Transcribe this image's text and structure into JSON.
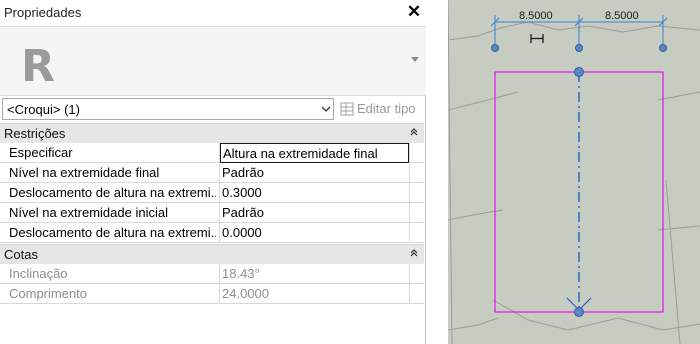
{
  "palette": {
    "title": "Propriedades",
    "close_glyph": "✕",
    "type_thumbnail_letter": "R",
    "instance_filter": "<Croqui> (1)",
    "edit_type_label": "Editar tipo"
  },
  "categories": [
    {
      "label": "Restrições",
      "rows": [
        {
          "name": "Especificar",
          "value": "Altura na extremidade final",
          "editing": true
        },
        {
          "name": "Nível na extremidade final",
          "value": "Padrão"
        },
        {
          "name": "Deslocamento de altura na extremi...",
          "value": "0.3000"
        },
        {
          "name": "Nível na extremidade inicial",
          "value": "Padrão"
        },
        {
          "name": "Deslocamento de altura na extremi...",
          "value": "0.0000"
        }
      ]
    },
    {
      "label": "Cotas",
      "rows": [
        {
          "name": "Inclinação",
          "value": "18.43°",
          "disabled": true
        },
        {
          "name": "Comprimento",
          "value": "24.0000",
          "disabled": true
        }
      ]
    }
  ],
  "canvas": {
    "dimension_left": "8.5000",
    "dimension_right": "8.5000",
    "colors": {
      "background": "#c6ccc2",
      "sketch_outline": "#e61ee6",
      "dimension": "#3a7fd5",
      "slope_arrow": "#1f5fbf"
    }
  }
}
